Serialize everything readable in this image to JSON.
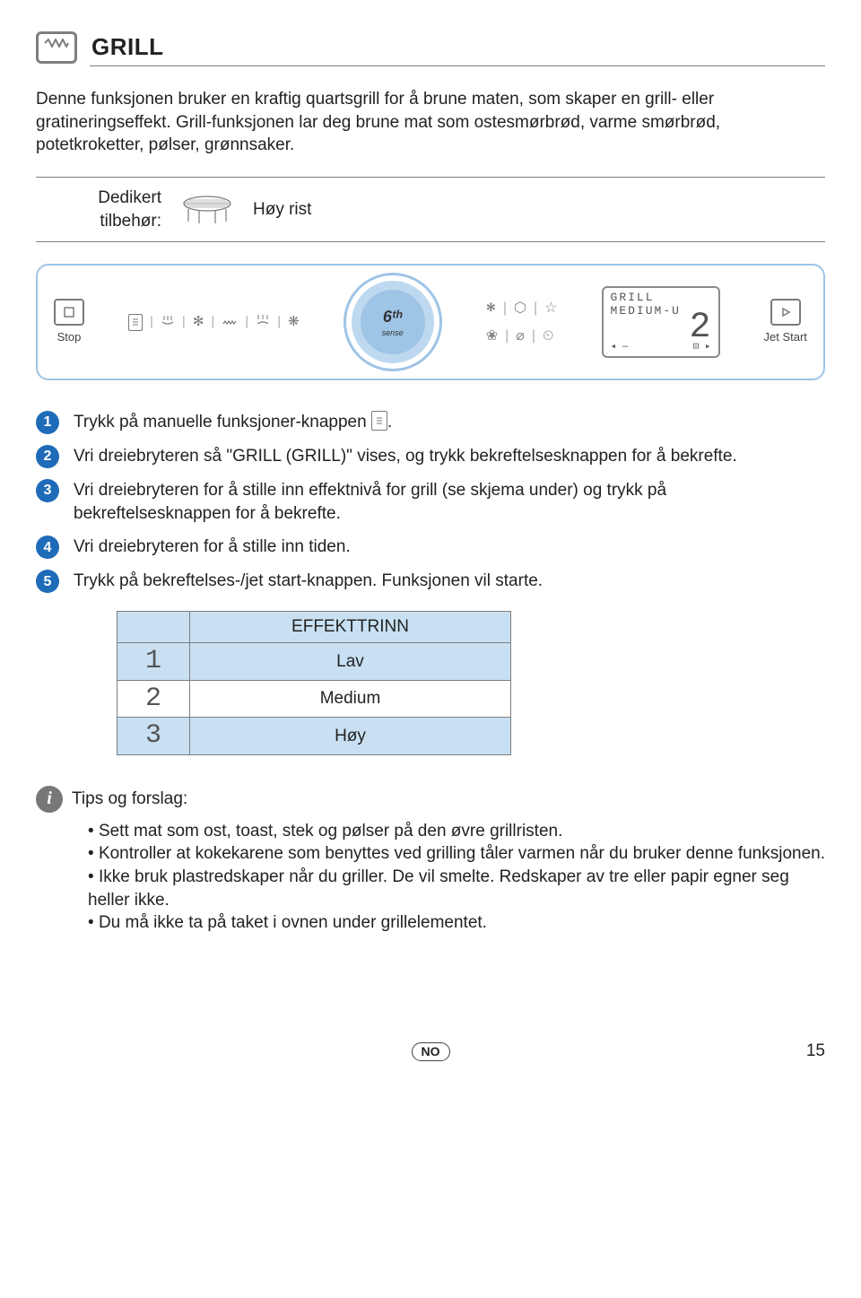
{
  "header": {
    "title": "GRILL"
  },
  "intro": "Denne funksjonen bruker en kraftig quartsgrill for å brune maten, som skaper en grill- eller gratineringseffekt. Grill-funksjonen lar deg brune mat som ostesmørbrød, varme smørbrød, potetkroketter, pølser, grønnsaker.",
  "accessory": {
    "label": "Dedikert tilbehør:",
    "value": "Høy rist"
  },
  "panel": {
    "stop_label": "Stop",
    "jetstart_label": "Jet Start",
    "dial_brand_top": "6ᵗʰ",
    "dial_brand_bottom": "sense",
    "display_line1": "GRILL",
    "display_line2": "MEDIUM-U",
    "display_value": "2"
  },
  "steps": [
    "Trykk på manuelle funksjoner-knappen ",
    "Vri dreiebryteren så \"GRILL (GRILL)\" vises, og trykk bekreftelsesknappen for å bekrefte.",
    "Vri dreiebryteren for å stille inn effektnivå for grill (se skjema under) og trykk på bekreftelsesknappen for å bekrefte.",
    "Vri dreiebryteren for å stille inn tiden.",
    "Trykk på bekreftelses-/jet start-knappen. Funksjonen vil starte."
  ],
  "step1_trailing": ".",
  "step_has_icon_index": 0,
  "table": {
    "header": "EFFEKTTRINN",
    "rows": [
      {
        "num": "1",
        "label": "Lav"
      },
      {
        "num": "2",
        "label": "Medium"
      },
      {
        "num": "3",
        "label": "Høy"
      }
    ]
  },
  "tips": {
    "title": "Tips og forslag:",
    "items": [
      "Sett mat som ost, toast, stek og pølser på den øvre grillristen.",
      "Kontroller at kokekarene som benyttes ved grilling tåler varmen når du bruker denne funksjonen.",
      "Ikke bruk plastredskaper når du griller. De vil smelte. Redskaper av tre eller papir egner seg heller ikke.",
      "Du må ikke ta på taket i ovnen under grillelementet."
    ]
  },
  "footer": {
    "lang": "NO",
    "page": "15"
  }
}
